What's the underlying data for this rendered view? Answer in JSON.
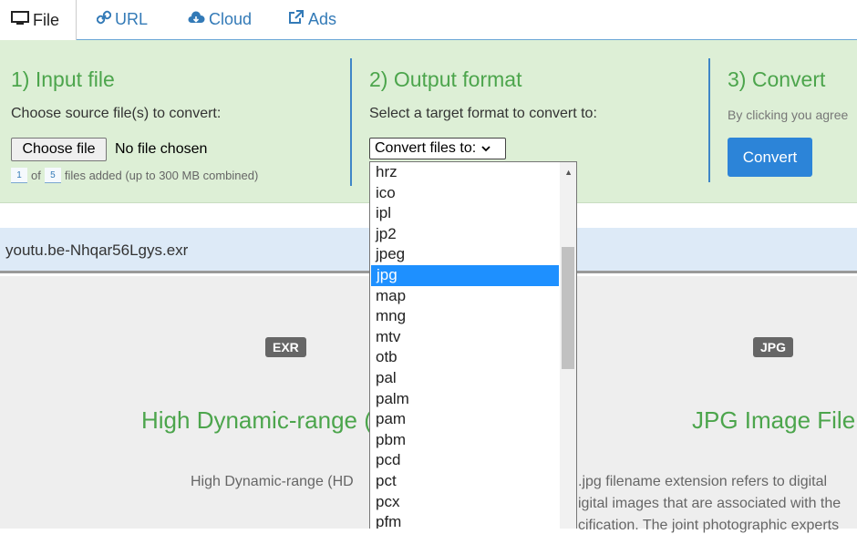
{
  "tabs": [
    {
      "label": "File",
      "icon": "monitor-icon"
    },
    {
      "label": "URL",
      "icon": "link-icon"
    },
    {
      "label": "Cloud",
      "icon": "cloud-download-icon"
    },
    {
      "label": "Ads",
      "icon": "external-link-icon"
    }
  ],
  "steps": {
    "input": {
      "title": "1) Input file",
      "text": "Choose source file(s) to convert:",
      "button": "Choose file",
      "no_file": "No file chosen",
      "count_current": "1",
      "count_of": "of",
      "count_total": "5",
      "count_suffix": "files added (up to 300 MB combined)"
    },
    "output": {
      "title": "2) Output format",
      "text": "Select a target format to convert to:",
      "select_value": "Convert files to:"
    },
    "convert": {
      "title": "3) Convert",
      "agree_text": "By clicking you agree",
      "button": "Convert"
    }
  },
  "file_row": {
    "name": "youtu.be-Nhqar56Lgys.exr"
  },
  "info": {
    "left_badge": "EXR",
    "right_badge": "JPG",
    "left_title": "High Dynamic-range (",
    "right_title": "JPG Image File",
    "left_text": "High Dynamic-range (HD",
    "right_text_1": ".jpg filename extension refers to digital",
    "right_text_2": "igital images that are associated with the",
    "right_text_3": "cification. The joint photographic experts"
  },
  "dropdown": {
    "options": [
      "hrz",
      "ico",
      "ipl",
      "jp2",
      "jpeg",
      "jpg",
      "map",
      "mng",
      "mtv",
      "otb",
      "pal",
      "palm",
      "pam",
      "pbm",
      "pcd",
      "pct",
      "pcx",
      "pfm"
    ],
    "selected": "jpg"
  },
  "colors": {
    "accent_green": "#4ca54c",
    "accent_blue": "#2c84d8",
    "selection": "#1e90ff"
  }
}
